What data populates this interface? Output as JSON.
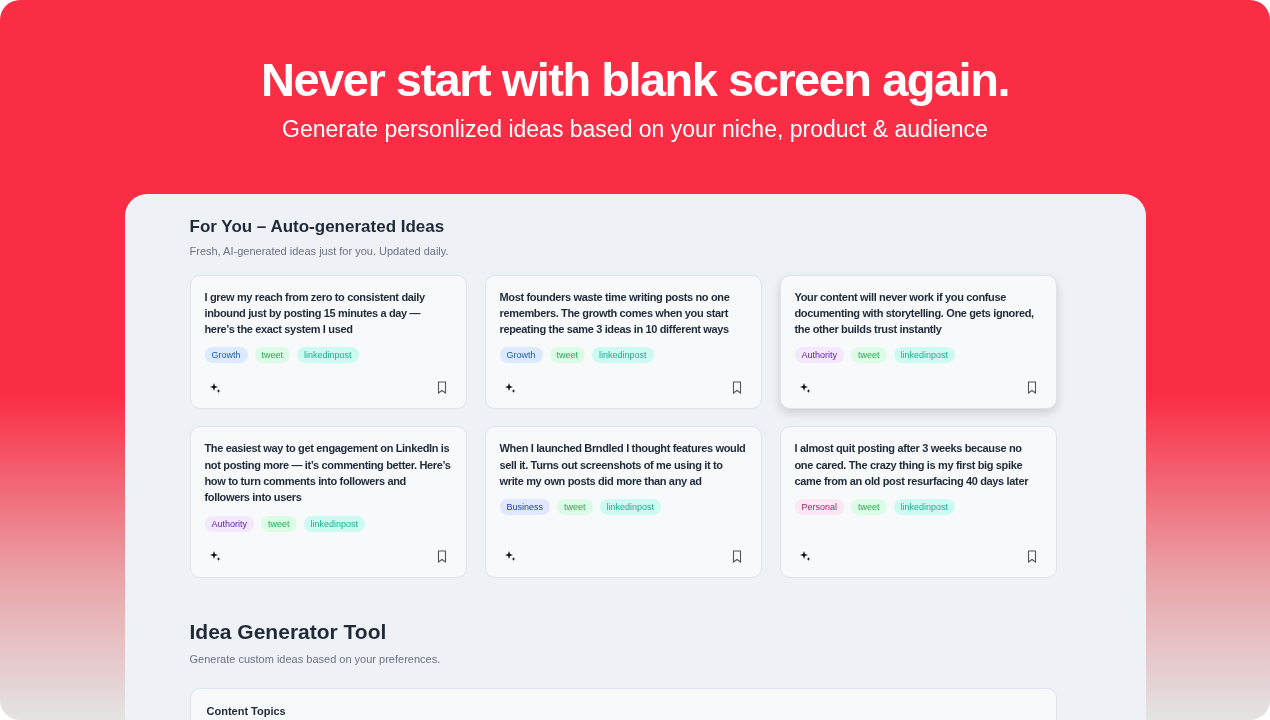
{
  "hero": {
    "title": "Never start with blank screen again.",
    "subtitle": "Generate personlized ideas based on your niche, product & audience"
  },
  "for_you": {
    "title": "For You – Auto-generated Ideas",
    "subtitle": "Fresh, AI-generated ideas just for you. Updated daily.",
    "cards": [
      {
        "text": "I grew my reach from zero to consistent daily inbound just by posting 15 minutes a day — here’s the exact system I used",
        "hovered": false,
        "tags": [
          {
            "label": "Growth",
            "color": "#dbeafe"
          },
          {
            "label": "tweet",
            "color": "#dcfce7"
          },
          {
            "label": "linkedinpost",
            "color": "#ccfbf1"
          }
        ]
      },
      {
        "text": "Most founders waste time writing posts no one remembers. The growth comes when you start repeating the same 3 ideas in 10 different ways",
        "hovered": false,
        "tags": [
          {
            "label": "Growth",
            "color": "#dbeafe"
          },
          {
            "label": "tweet",
            "color": "#dcfce7"
          },
          {
            "label": "linkedinpost",
            "color": "#ccfbf1"
          }
        ]
      },
      {
        "text": "Your content will never work if you confuse documenting with storytelling. One gets ignored, the other builds trust instantly",
        "hovered": true,
        "tags": [
          {
            "label": "Authority",
            "color": "#f3e8ff"
          },
          {
            "label": "tweet",
            "color": "#dcfce7"
          },
          {
            "label": "linkedinpost",
            "color": "#ccfbf1"
          }
        ]
      },
      {
        "text": "The easiest way to get engagement on LinkedIn is not posting more — it’s commenting better. Here’s how to turn comments into followers and followers into users",
        "hovered": false,
        "tags": [
          {
            "label": "Authority",
            "color": "#f3e8ff"
          },
          {
            "label": "tweet",
            "color": "#dcfce7"
          },
          {
            "label": "linkedinpost",
            "color": "#ccfbf1"
          }
        ]
      },
      {
        "text": "When I launched Brndled I thought features would sell it. Turns out screenshots of me using it to write my own posts did more than any ad",
        "hovered": false,
        "tags": [
          {
            "label": "Business",
            "color": "#e0e7ff"
          },
          {
            "label": "tweet",
            "color": "#dcfce7"
          },
          {
            "label": "linkedinpost",
            "color": "#ccfbf1"
          }
        ]
      },
      {
        "text": "I almost quit posting after 3 weeks because no one cared. The crazy thing is my first big spike came from an old post resurfacing 40 days later",
        "hovered": false,
        "tags": [
          {
            "label": "Personal",
            "color": "#fce7f3"
          },
          {
            "label": "tweet",
            "color": "#dcfce7"
          },
          {
            "label": "linkedinpost",
            "color": "#ccfbf1"
          }
        ]
      }
    ]
  },
  "generator": {
    "title": "Idea Generator Tool",
    "subtitle": "Generate custom ideas based on your preferences.",
    "panel_title": "Content Topics"
  }
}
